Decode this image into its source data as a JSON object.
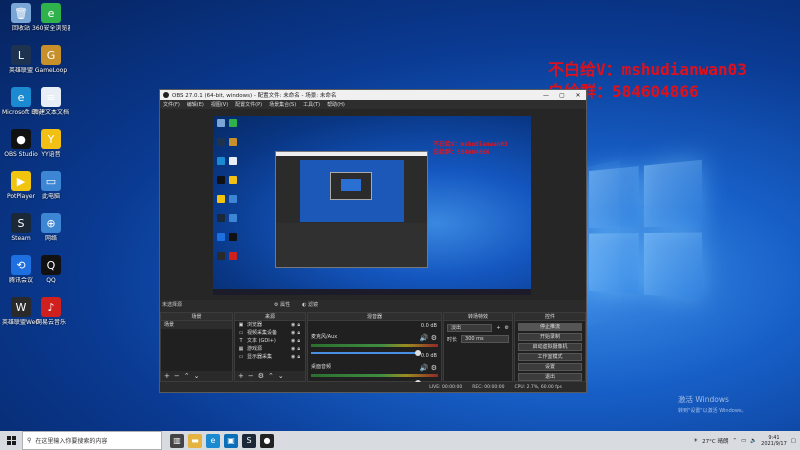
{
  "desktop": {
    "icons": [
      {
        "label": "回收站",
        "color": "#7aa6d6",
        "glyph": "🗑"
      },
      {
        "label": "360安全浏览器",
        "color": "#2fb24c",
        "glyph": "e"
      },
      {
        "label": "英雄联盟",
        "color": "#1d3350",
        "glyph": "L"
      },
      {
        "label": "GameLoop",
        "color": "#c8902a",
        "glyph": "G"
      },
      {
        "label": "Microsoft Edge",
        "color": "#1b8ad0",
        "glyph": "e"
      },
      {
        "label": "新建文本文档",
        "color": "#e8eef6",
        "glyph": "≡"
      },
      {
        "label": "OBS Studio",
        "color": "#111111",
        "glyph": "●"
      },
      {
        "label": "YY语音",
        "color": "#f2c014",
        "glyph": "Y"
      },
      {
        "label": "PotPlayer",
        "color": "#f1c40f",
        "glyph": "▶"
      },
      {
        "label": "此电脑",
        "color": "#3c86d4",
        "glyph": "▭"
      },
      {
        "label": "Steam",
        "color": "#1b2838",
        "glyph": "S"
      },
      {
        "label": "网络",
        "color": "#3c86d4",
        "glyph": "⊕"
      },
      {
        "label": "腾讯会议",
        "color": "#1e6fe0",
        "glyph": "⟲"
      },
      {
        "label": "QQ",
        "color": "#111111",
        "glyph": "Q"
      },
      {
        "label": "英雄联盟WeGame",
        "color": "#2a2a2a",
        "glyph": "W"
      },
      {
        "label": "网易云音乐",
        "color": "#d0201e",
        "glyph": "♪"
      }
    ]
  },
  "overlay": {
    "line1": "不白给V：mshudianwan03",
    "line2": "白给群：584604866"
  },
  "obs": {
    "title": "OBS 27.0.1 (64-bit, windows) - 配置文件: 未命名 - 场景: 未命名",
    "menu": [
      "文件(F)",
      "编辑(E)",
      "视图(V)",
      "配置文件(P)",
      "场景集合(S)",
      "工具(T)",
      "帮助(H)"
    ],
    "no_source": "未选择源",
    "props_label": "属性",
    "filters_label": "滤镜",
    "docks": {
      "scenes": "场景",
      "sources": "来源",
      "mixer": "混音器",
      "transitions": "转场特效",
      "controls": "控件"
    },
    "scene_item": "场景",
    "sources": [
      {
        "icon": "▣",
        "label": "浏览器"
      },
      {
        "icon": "▭",
        "label": "视频采集设备"
      },
      {
        "icon": "T",
        "label": "文本 (GDI+)"
      },
      {
        "icon": "▦",
        "label": "游戏源"
      },
      {
        "icon": "▭",
        "label": "显示器采集"
      }
    ],
    "mixer": [
      {
        "name": "麦克风/Aux",
        "db": "0.0 dB"
      },
      {
        "name": "桌面音频",
        "db": "0.0 dB"
      }
    ],
    "transition": {
      "type": "淡出",
      "duration_label": "时长",
      "duration": "300 ms"
    },
    "controls": [
      "停止推流",
      "开始录制",
      "启动虚拟摄像机",
      "工作室模式",
      "设置",
      "退出"
    ],
    "status": {
      "drop": "LIVE: 00:00:00",
      "rec": "REC: 00:00:00",
      "cpu": "CPU: 2.7%, 60.00 fps"
    }
  },
  "activation": {
    "line1": "激活 Windows",
    "line2": "转到\"设置\"以激活 Windows。"
  },
  "taskbar": {
    "search_placeholder": "在这里输入你要搜索的内容",
    "weather": "27°C 晴朗",
    "time": "9:41",
    "date": "2021/9/17"
  }
}
